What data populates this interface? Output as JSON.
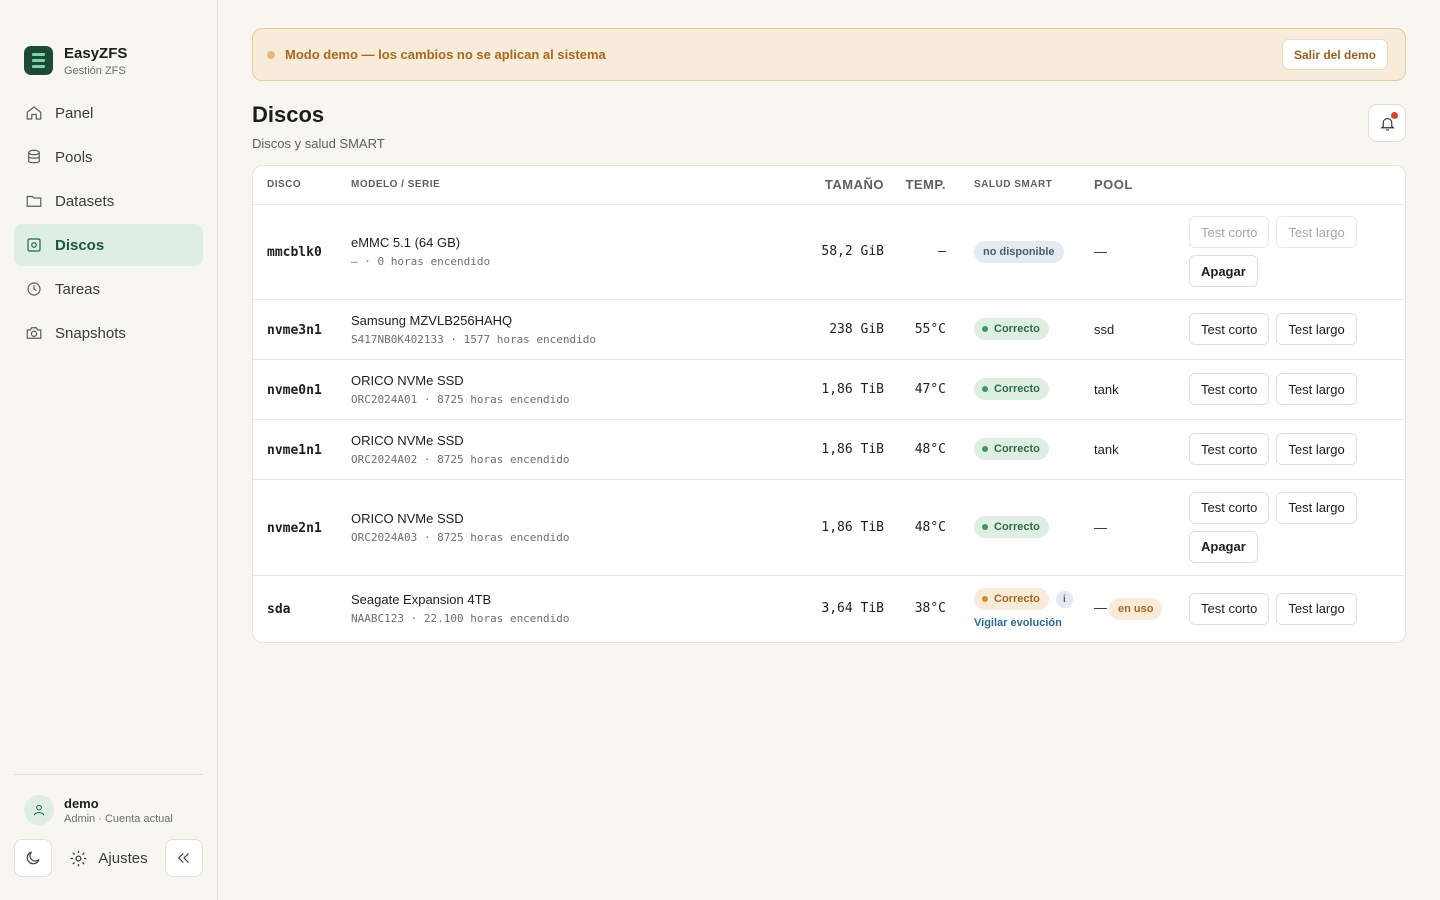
{
  "brand": {
    "name": "EasyZFS",
    "subtitle": "Gestión ZFS"
  },
  "nav": [
    {
      "label": "Panel",
      "icon": "home-icon",
      "active": false
    },
    {
      "label": "Pools",
      "icon": "database-icon",
      "active": false
    },
    {
      "label": "Datasets",
      "icon": "folder-icon",
      "active": false
    },
    {
      "label": "Discos",
      "icon": "disk-icon",
      "active": true
    },
    {
      "label": "Tareas",
      "icon": "clock-icon",
      "active": false
    },
    {
      "label": "Snapshots",
      "icon": "camera-icon",
      "active": false
    }
  ],
  "user": {
    "name": "demo",
    "role": "Admin · Cuenta actual"
  },
  "sidebar_bottom": {
    "settings_label": "Ajustes"
  },
  "banner": {
    "text": "Modo demo — los cambios no se aplican al sistema",
    "button": "Salir del demo"
  },
  "page": {
    "title": "Discos",
    "subtitle": "Discos y salud SMART"
  },
  "table": {
    "headers": {
      "disk": "Disco",
      "model": "Modelo / Serie",
      "size": "Tamaño",
      "temp": "Temp.",
      "smart": "Salud SMART",
      "pool": "Pool"
    },
    "rows": [
      {
        "disk": "mmcblk0",
        "model": "eMMC 5.1 (64 GB)",
        "serial": "— · 0 horas encendido",
        "size": "58,2 GiB",
        "temp": "—",
        "smart": "no disponible",
        "smart_kind": "na",
        "pool": "—",
        "short": "Test corto",
        "long": "Test largo",
        "tests_disabled": true,
        "off": "Apagar"
      },
      {
        "disk": "nvme3n1",
        "model": "Samsung MZVLB256HAHQ",
        "serial": "S417NB0K402133 · 1577 horas encendido",
        "size": "238 GiB",
        "temp": "55°C",
        "smart": "Correcto",
        "smart_kind": "ok",
        "pool": "ssd",
        "short": "Test corto",
        "long": "Test largo"
      },
      {
        "disk": "nvme0n1",
        "model": "ORICO NVMe SSD",
        "serial": "ORC2024A01 · 8725 horas encendido",
        "size": "1,86 TiB",
        "temp": "47°C",
        "smart": "Correcto",
        "smart_kind": "ok",
        "pool": "tank",
        "short": "Test corto",
        "long": "Test largo"
      },
      {
        "disk": "nvme1n1",
        "model": "ORICO NVMe SSD",
        "serial": "ORC2024A02 · 8725 horas encendido",
        "size": "1,86 TiB",
        "temp": "48°C",
        "smart": "Correcto",
        "smart_kind": "ok",
        "pool": "tank",
        "short": "Test corto",
        "long": "Test largo"
      },
      {
        "disk": "nvme2n1",
        "model": "ORICO NVMe SSD",
        "serial": "ORC2024A03 · 8725 horas encendido",
        "size": "1,86 TiB",
        "temp": "48°C",
        "smart": "Correcto",
        "smart_kind": "ok",
        "pool": "—",
        "short": "Test corto",
        "long": "Test largo",
        "off": "Apagar"
      },
      {
        "disk": "sda",
        "model": "Seagate Expansion 4TB",
        "serial": "NAABC123 · 22.100 horas encendido",
        "size": "3,64 TiB",
        "temp": "38°C",
        "smart": "Correcto",
        "smart_kind": "warn",
        "smart_info": "i",
        "smart_link": "Vigilar evolución",
        "pool": "—",
        "pool_badge": "en uso",
        "short": "Test corto",
        "long": "Test largo"
      }
    ]
  },
  "colors": {
    "accent": "#1d4a37",
    "active_bg": "#dfeee3",
    "warn_bg": "#f9ebd9",
    "warn_text": "#a6691f"
  }
}
